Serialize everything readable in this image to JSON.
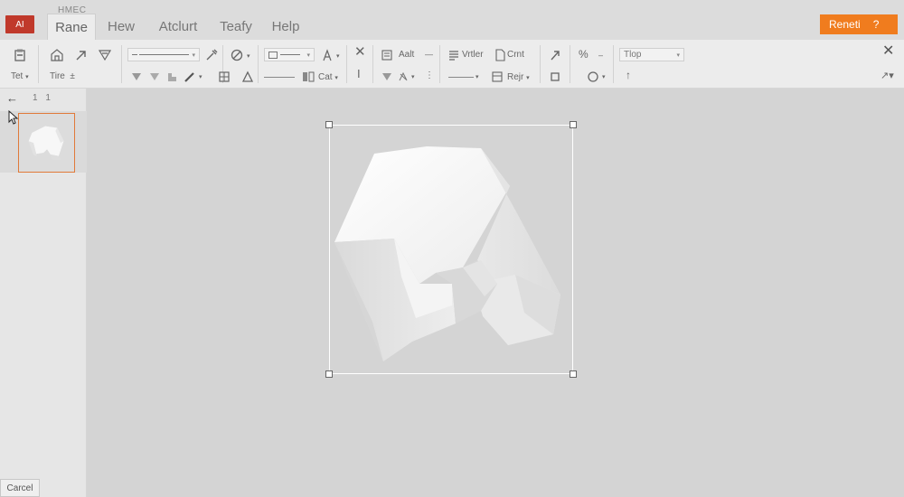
{
  "app": {
    "badge": "AI",
    "doc_title": "HMEC"
  },
  "tabs": [
    {
      "label": "Rane",
      "active": true
    },
    {
      "label": "Hew",
      "active": false
    },
    {
      "label": "Atclurt",
      "active": false
    },
    {
      "label": "Teafy",
      "active": false
    },
    {
      "label": "Help",
      "active": false
    }
  ],
  "accent_button": {
    "label": "Reneti",
    "help": "?",
    "color": "#f07c1e"
  },
  "ribbon": {
    "group1": {
      "top_label": "",
      "bottom_label": "Tet",
      "icon": "paste-icon"
    },
    "group2": {
      "bottom_label": "Tire",
      "bottom_suffix": "±"
    },
    "dropdown_line": "",
    "dropdown_view": "",
    "text_right_1": "Aalt",
    "text_right_2": "Vrtler",
    "text_right_3": "Crnt",
    "text_right_4": "Rejr",
    "text_cat": "Cat",
    "dropdown_right": "Tlop"
  },
  "left_panel": {
    "page_numbers": "1 1",
    "cancel_label": "Carcel"
  },
  "colors": {
    "accent": "#f07c1e",
    "badge": "#c0392b",
    "thumb_border": "#e07a3a"
  }
}
